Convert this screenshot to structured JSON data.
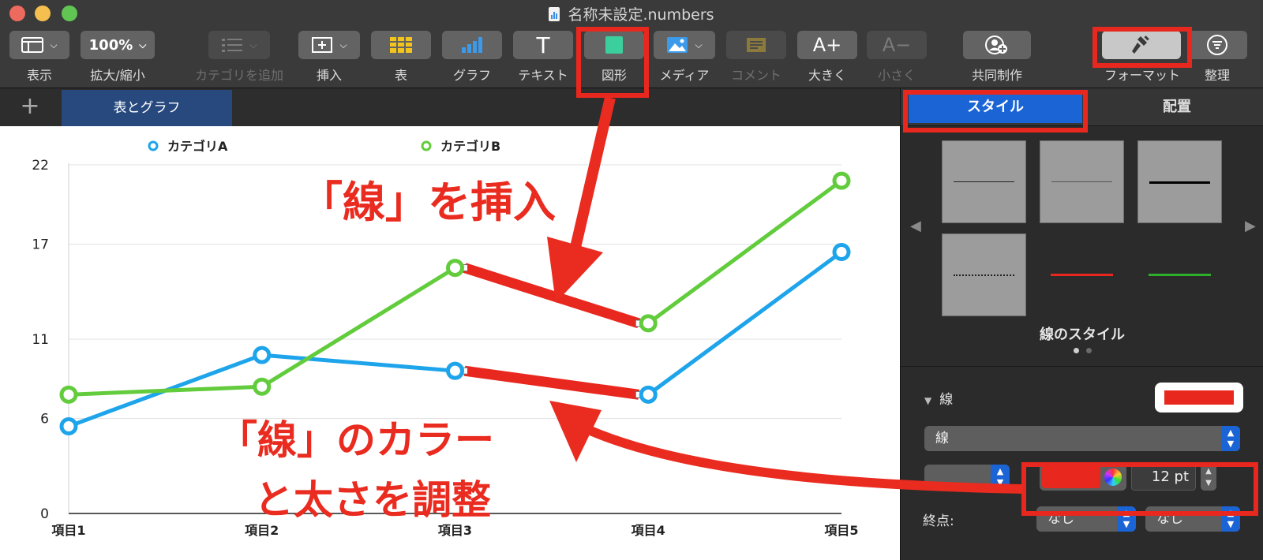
{
  "window": {
    "title": "名称未設定.numbers",
    "traffic_lights": {
      "close": "#ed6a5e",
      "minimize": "#f5bf4f",
      "zoom": "#61c554"
    }
  },
  "toolbar": {
    "view": {
      "label": "表示",
      "icon": "sidebar-icon"
    },
    "zoom": {
      "label": "拡大/縮小",
      "value": "100%"
    },
    "add_category": {
      "label": "カテゴリを追加",
      "icon": "list-icon"
    },
    "insert": {
      "label": "挿入",
      "icon": "insert-icon"
    },
    "table": {
      "label": "表",
      "icon": "table-icon"
    },
    "chart": {
      "label": "グラフ",
      "icon": "bar-chart-icon"
    },
    "text": {
      "label": "テキスト",
      "icon": "T"
    },
    "shape": {
      "label": "図形",
      "icon": "shape-square-icon"
    },
    "media": {
      "label": "メディア",
      "icon": "image-icon"
    },
    "comment": {
      "label": "コメント",
      "icon": "comment-icon"
    },
    "bigger": {
      "label": "大きく",
      "icon": "A+"
    },
    "smaller": {
      "label": "小さく",
      "icon": "A−"
    },
    "collaborate": {
      "label": "共同制作",
      "icon": "collaborate-icon"
    },
    "format": {
      "label": "フォーマット",
      "icon": "paintbrush-icon"
    },
    "organize": {
      "label": "整理",
      "icon": "organize-icon"
    }
  },
  "sheets": {
    "add_label": "+",
    "active_tab": "表とグラフ"
  },
  "chart_data": {
    "type": "line",
    "categories": [
      "項目1",
      "項目2",
      "項目3",
      "項目4",
      "項目5"
    ],
    "series": [
      {
        "name": "カテゴリA",
        "color": "#1ea4ea",
        "values": [
          5.5,
          10,
          9,
          7.5,
          16.5
        ]
      },
      {
        "name": "カテゴリB",
        "color": "#62cc3c",
        "values": [
          7.5,
          8,
          15.5,
          12,
          21
        ]
      }
    ],
    "yticks": [
      "0",
      "6",
      "11",
      "17",
      "22"
    ],
    "ylim": [
      0,
      22
    ],
    "grid": true,
    "legend": "top",
    "inserted_lines": {
      "color": "#e8281e"
    }
  },
  "panel": {
    "tabs": {
      "style": "スタイル",
      "arrange": "配置"
    },
    "style_caption": "線のスタイル",
    "section_title": "線",
    "line_type": "線",
    "color_hex": "#e8281e",
    "width_value": "12 pt",
    "endpoints_label": "終点:",
    "endpoint_start": "なし",
    "endpoint_end": "なし"
  },
  "annotations": {
    "insert_line": "「線」を挿入",
    "adjust_line_1": "「線」のカラー",
    "adjust_line_2": "と太さを調整"
  },
  "highlight_color": "#e8281e"
}
